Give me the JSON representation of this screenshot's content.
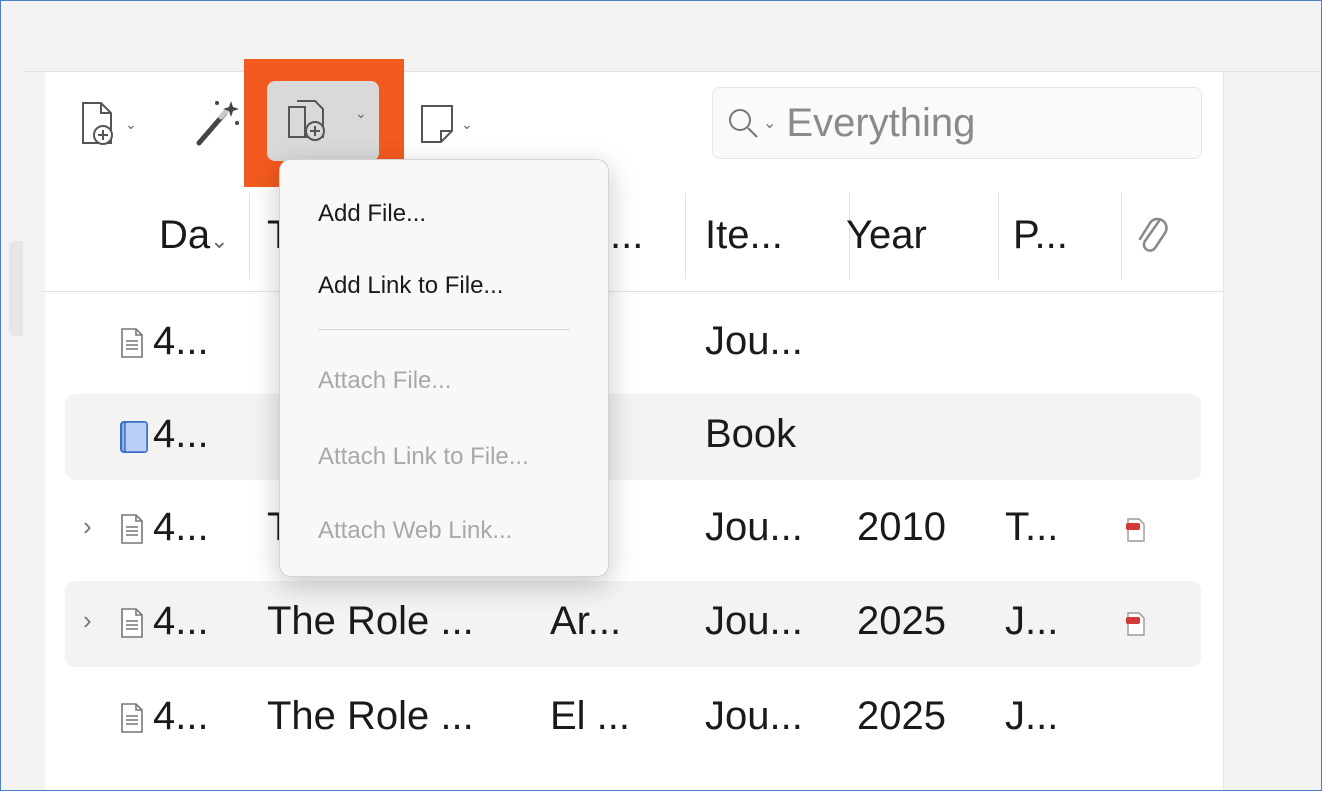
{
  "toolbar": {
    "new_item_icon": "new-item-icon",
    "magic_wand_icon": "magic-wand-icon",
    "add_attachment_icon": "add-attachment-icon",
    "new_note_icon": "new-note-icon",
    "dropdown_glyph": "⌄"
  },
  "search": {
    "icon": "search-icon",
    "mode_glyph": "⌄",
    "placeholder": "Everything"
  },
  "columns": [
    "Da",
    "T",
    "...",
    "Ite...",
    "Year",
    "P...",
    "attachment-icon"
  ],
  "column_sort_glyph": "⌄",
  "rows": [
    {
      "type_icon": "journal-article-icon",
      "twisty": "",
      "date": "4...",
      "title": "",
      "creator": "",
      "item_type": "Jou...",
      "year": "",
      "publication": "",
      "attachment": ""
    },
    {
      "type_icon": "book-icon",
      "twisty": "",
      "date": "4...",
      "title": "",
      "creator": "",
      "item_type": "Book",
      "year": "",
      "publication": "",
      "attachment": ""
    },
    {
      "type_icon": "journal-article-icon",
      "twisty": "›",
      "date": "4...",
      "title": "T",
      "creator": "...",
      "item_type": "Jou...",
      "year": "2010",
      "publication": "T...",
      "attachment": "pdf-icon"
    },
    {
      "type_icon": "journal-article-icon",
      "twisty": "›",
      "date": "4...",
      "title": "The Role ...",
      "creator": "Ar...",
      "item_type": "Jou...",
      "year": "2025",
      "publication": "J...",
      "attachment": "pdf-icon"
    },
    {
      "type_icon": "journal-article-icon",
      "twisty": "",
      "date": "4...",
      "title": "The Role ...",
      "creator": "El ...",
      "item_type": "Jou...",
      "year": "2025",
      "publication": "J...",
      "attachment": ""
    }
  ],
  "menu": {
    "items": [
      {
        "label": "Add File...",
        "enabled": true
      },
      {
        "label": "Add Link to File...",
        "enabled": true
      },
      {
        "label": "Attach File...",
        "enabled": false
      },
      {
        "label": "Attach Link to File...",
        "enabled": false
      },
      {
        "label": "Attach Web Link...",
        "enabled": false
      }
    ]
  },
  "colors": {
    "highlight": "#f25a1f",
    "frame_border": "#4a80c8",
    "book_icon": "#4a7fd8",
    "pdf_icon": "#d23a3a"
  }
}
